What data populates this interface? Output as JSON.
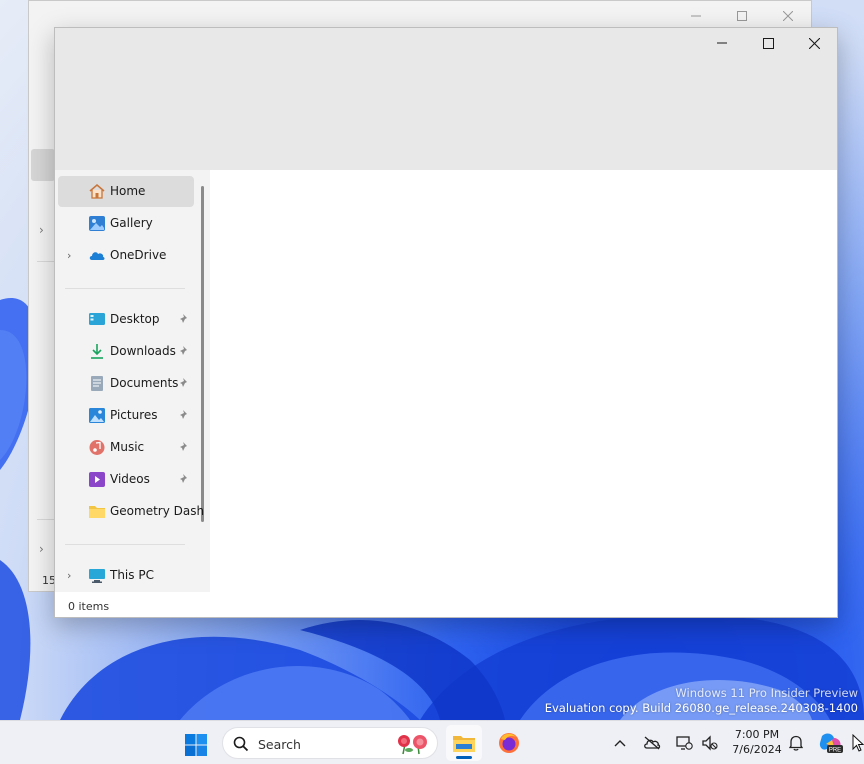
{
  "desktop": {
    "watermark_line1": "Windows 11 Pro Insider Preview",
    "watermark_line2": "Evaluation copy. Build 26080.ge_release.240308-1400"
  },
  "back_window": {
    "item_count_fragment": "15"
  },
  "explorer": {
    "nav": {
      "home": "Home",
      "gallery": "Gallery",
      "onedrive": "OneDrive",
      "desktop": "Desktop",
      "downloads": "Downloads",
      "documents": "Documents",
      "pictures": "Pictures",
      "music": "Music",
      "videos": "Videos",
      "geometry_dash": "Geometry Dash",
      "this_pc": "This PC"
    },
    "status": "0 items"
  },
  "taskbar": {
    "search_placeholder": "Search",
    "time": "7:00 PM",
    "date": "7/6/2024"
  },
  "colors": {
    "accent": "#005fb8",
    "selected_nav": "#dcdcdc",
    "titlebar": "#e8e8e8"
  }
}
